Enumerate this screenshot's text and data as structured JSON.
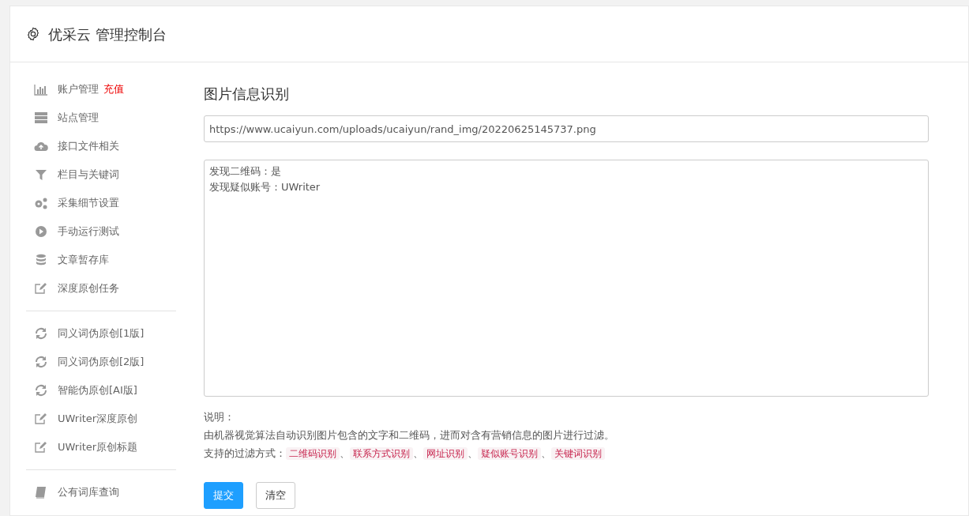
{
  "header": {
    "title": "优采云 管理控制台"
  },
  "sidebar": {
    "groups": [
      [
        {
          "label": "账户管理",
          "kind": "chart",
          "badge": "充值"
        },
        {
          "label": "站点管理",
          "kind": "server"
        },
        {
          "label": "接口文件相关",
          "kind": "cloud"
        },
        {
          "label": "栏目与关键词",
          "kind": "filter"
        },
        {
          "label": "采集细节设置",
          "kind": "gears"
        },
        {
          "label": "手动运行测试",
          "kind": "play"
        },
        {
          "label": "文章暂存库",
          "kind": "database"
        },
        {
          "label": "深度原创任务",
          "kind": "edit"
        }
      ],
      [
        {
          "label": "同义词伪原创[1版]",
          "kind": "refresh"
        },
        {
          "label": "同义词伪原创[2版]",
          "kind": "refresh"
        },
        {
          "label": "智能伪原创[AI版]",
          "kind": "refresh"
        },
        {
          "label": "UWriter深度原创",
          "kind": "edit"
        },
        {
          "label": "UWriter原创标题",
          "kind": "edit"
        }
      ],
      [
        {
          "label": "公有词库查询",
          "kind": "book"
        }
      ]
    ]
  },
  "main": {
    "title": "图片信息识别",
    "url_field": {
      "value": "https://www.ucaiyun.com/uploads/ucaiyun/rand_img/20220625145737.png"
    },
    "result_box": {
      "lines": [
        "发现二维码：是",
        "发现疑似账号：UWriter"
      ]
    },
    "notes_heading": "说明：",
    "description": "由机器视觉算法自动识别图片包含的文字和二维码，进而对含有营销信息的图片进行过滤。",
    "filters_label": "支持的过滤方式：",
    "filters": [
      "二维码识别",
      "联系方式识别",
      "网址识别",
      "疑似账号识别",
      "关键词识别"
    ],
    "separator": "、",
    "buttons": [
      {
        "label": "提交",
        "kind": "primary"
      },
      {
        "label": "清空",
        "kind": "plain"
      }
    ]
  }
}
